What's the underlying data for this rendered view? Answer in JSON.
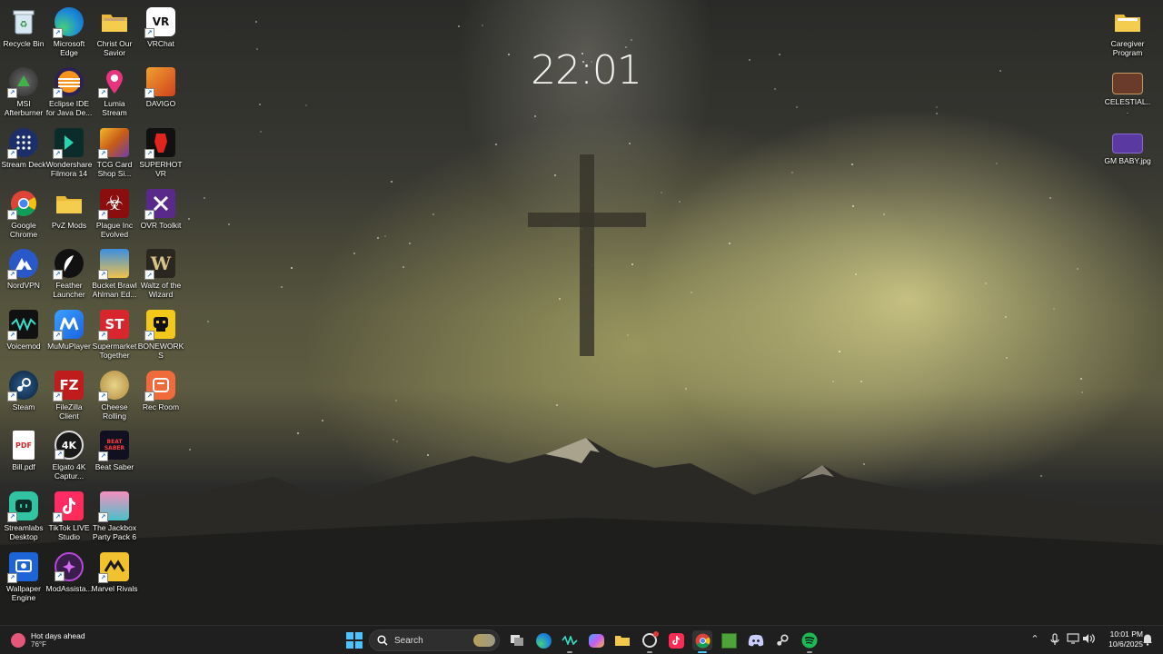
{
  "wallpaper": {
    "clock_time": "22:01"
  },
  "desktop": {
    "icons": [
      {
        "label": "Recycle Bin"
      },
      {
        "label": "Microsoft Edge"
      },
      {
        "label": "Christ Our Savior"
      },
      {
        "label": "VRChat"
      },
      {
        "label": "MSI Afterburner"
      },
      {
        "label": "Eclipse IDE for Java De..."
      },
      {
        "label": "Lumia Stream"
      },
      {
        "label": "DAVIGO"
      },
      {
        "label": "Stream Deck"
      },
      {
        "label": "Wondershare Filmora 14"
      },
      {
        "label": "TCG Card Shop Si..."
      },
      {
        "label": "SUPERHOT VR"
      },
      {
        "label": "Google Chrome"
      },
      {
        "label": "PvZ Mods"
      },
      {
        "label": "Plague Inc Evolved"
      },
      {
        "label": "OVR Toolkit"
      },
      {
        "label": "NordVPN"
      },
      {
        "label": "Feather Launcher"
      },
      {
        "label": "Bucket Brawl Ahlman Ed..."
      },
      {
        "label": "Waltz of the Wizard"
      },
      {
        "label": "Voicemod"
      },
      {
        "label": "MuMuPlayer"
      },
      {
        "label": "Supermarket Together"
      },
      {
        "label": "BONEWORKS"
      },
      {
        "label": "Steam"
      },
      {
        "label": "FileZilla Client"
      },
      {
        "label": "Cheese Rolling"
      },
      {
        "label": "Rec Room"
      },
      {
        "label": "Bill.pdf"
      },
      {
        "label": "Elgato 4K Captur..."
      },
      {
        "label": "Beat Saber"
      },
      {
        "label": "Streamlabs Desktop"
      },
      {
        "label": "TikTok LIVE Studio"
      },
      {
        "label": "The Jackbox Party Pack 6"
      },
      {
        "label": "Wallpaper Engine"
      },
      {
        "label": "ModAssista..."
      },
      {
        "label": "Marvel Rivals"
      },
      {
        "label": "Caregiver Program"
      },
      {
        "label": "CELESTIAL..."
      },
      {
        "label": "GM BABY.jpg"
      }
    ],
    "icon_glyphs": {
      "vrchat": "VR",
      "pdf": "PDF",
      "elgato": "4K",
      "filezilla": "FZ",
      "supermarket": "ST",
      "waltz": "W",
      "beatsaber": "BEAT SABER"
    },
    "colors": {
      "edge": "#1e8bd8",
      "chrome_red": "#db4437",
      "chrome_yellow": "#f4c20d",
      "chrome_green": "#0f9d58",
      "folder": "#f4c84a",
      "nordvpn": "#2b58c9",
      "steam": "#1b2838",
      "filezilla": "#bf1d1d",
      "tiktok": "#fe2c55",
      "spotify": "#1db954",
      "minecraft": "#4ea33a",
      "discord": "#5865f2"
    }
  },
  "taskbar": {
    "weather": {
      "title": "Hot days ahead",
      "temp": "76°F"
    },
    "search": {
      "label": "Search"
    },
    "apps": [
      {
        "name": "task-view"
      },
      {
        "name": "edge"
      },
      {
        "name": "voicemod"
      },
      {
        "name": "copilot"
      },
      {
        "name": "file-explorer"
      },
      {
        "name": "obs"
      },
      {
        "name": "tiktok"
      },
      {
        "name": "chrome"
      },
      {
        "name": "minecraft"
      },
      {
        "name": "discord"
      },
      {
        "name": "steam"
      },
      {
        "name": "spotify"
      }
    ],
    "clock": {
      "time": "10:01 PM",
      "date": "10/6/2025"
    }
  }
}
